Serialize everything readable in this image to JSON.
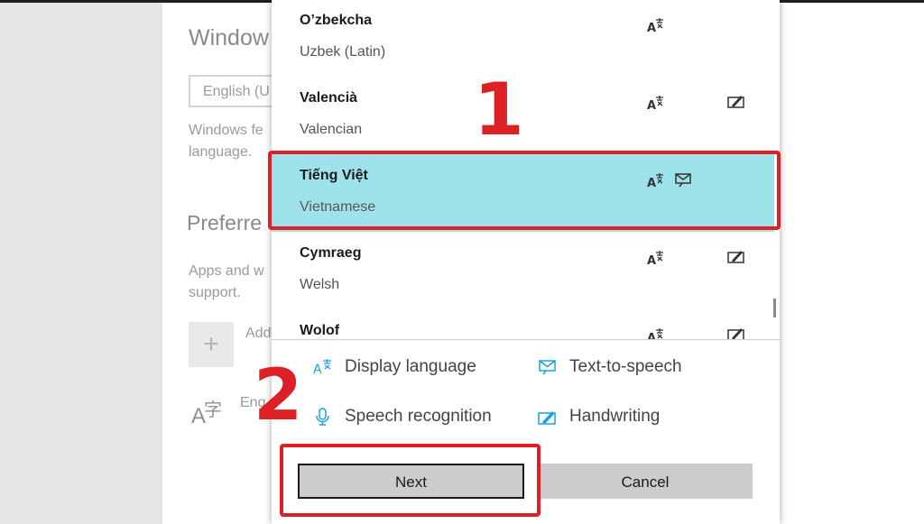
{
  "background_settings": {
    "title": "Window",
    "combo_value": "English (U",
    "description_1": [
      "Windows fe",
      "language."
    ],
    "preferred_heading": "Preferre",
    "description_2": [
      "Apps and w",
      "support."
    ],
    "add_symbol": "+",
    "add_label": "Add",
    "lang_icon_a": "A",
    "lang_icon_char": "字",
    "lang_entry": "Eng"
  },
  "dialog": {
    "languages": [
      {
        "name": "O’zbekcha",
        "english": "Uzbek (Latin)",
        "features": [
          "display-language"
        ]
      },
      {
        "name": "Valencià",
        "english": "Valencian",
        "features": [
          "display-language",
          "handwriting"
        ]
      },
      {
        "name": "Tiếng Việt",
        "english": "Vietnamese",
        "features": [
          "display-language",
          "text-to-speech"
        ],
        "selected": true
      },
      {
        "name": "Cymraeg",
        "english": "Welsh",
        "features": [
          "display-language",
          "handwriting"
        ]
      },
      {
        "name": "Wolof",
        "english": "",
        "features": [
          "display-language",
          "handwriting"
        ]
      }
    ],
    "legend": {
      "display_language": "Display language",
      "text_to_speech": "Text-to-speech",
      "speech_recognition": "Speech recognition",
      "handwriting": "Handwriting"
    },
    "buttons": {
      "next": "Next",
      "cancel": "Cancel"
    }
  },
  "annotations": {
    "step_1": "1",
    "step_2": "2"
  },
  "colors": {
    "accent_blue": "#1ba1e2",
    "selected_row": "#9ee3ec",
    "annotation_red": "#dd1f26"
  }
}
